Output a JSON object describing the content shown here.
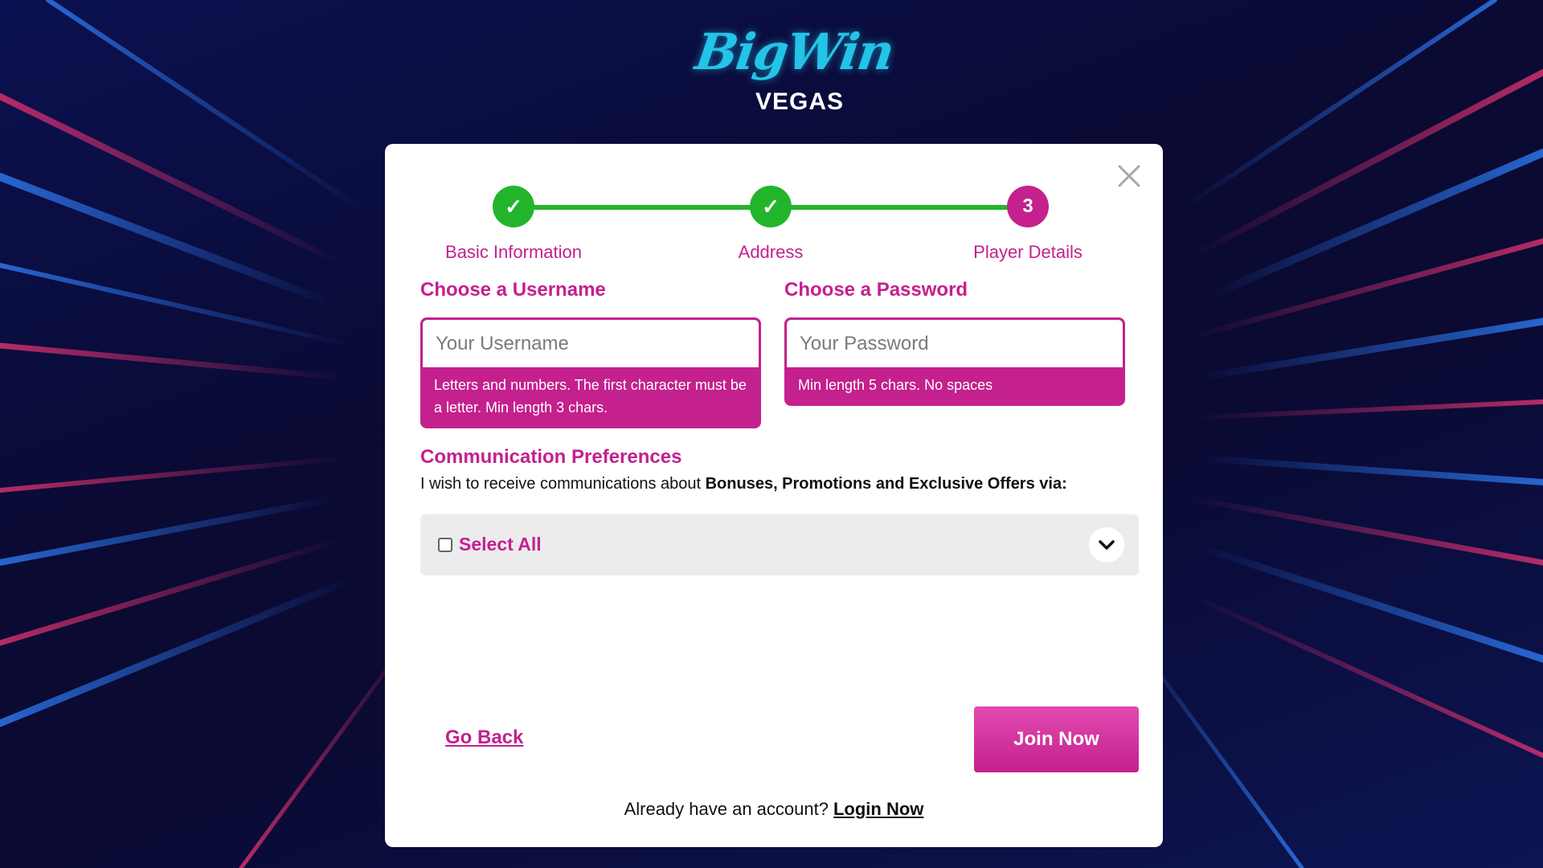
{
  "brand": {
    "logo_script": "BigWin",
    "logo_sub": "VEGAS"
  },
  "steps": [
    {
      "label": "Basic Information",
      "state": "done",
      "marker": "✓"
    },
    {
      "label": "Address",
      "state": "done",
      "marker": "✓"
    },
    {
      "label": "Player Details",
      "state": "current",
      "marker": "3"
    }
  ],
  "username": {
    "title": "Choose a Username",
    "placeholder": "Your Username",
    "value": "",
    "hint": "Letters and numbers. The first character must be a letter. Min length 3 chars."
  },
  "password": {
    "title": "Choose a Password",
    "placeholder": "Your Password",
    "value": "",
    "hint": "Min length 5 chars. No spaces"
  },
  "communication": {
    "title": "Communication Preferences",
    "text_prefix": "I wish to receive communications about ",
    "text_bold": "Bonuses, Promotions and Exclusive Offers via:",
    "select_all_label": "Select All"
  },
  "actions": {
    "go_back": "Go Back",
    "join_now": "Join Now",
    "already_text": "Already have an account?",
    "login_now": "Login Now"
  },
  "colors": {
    "accent": "#c4208e",
    "success": "#22b52c",
    "logo_blue": "#23c4e8"
  },
  "icons": {
    "close": "close-icon",
    "check": "check-icon",
    "chevron": "chevron-down-icon"
  }
}
